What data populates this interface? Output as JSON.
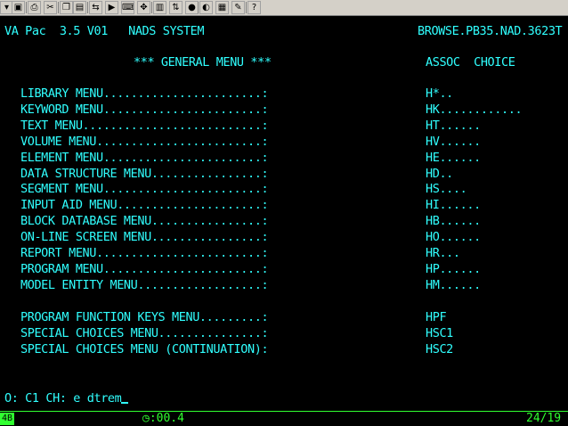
{
  "toolbar": {
    "buttons": [
      {
        "name": "dropdown-button",
        "glyph": "▾"
      },
      {
        "name": "save-icon",
        "glyph": "▣"
      },
      {
        "name": "print-icon",
        "glyph": "⎙"
      },
      {
        "name": "cut-icon",
        "glyph": "✂"
      },
      {
        "name": "copy-icon",
        "glyph": "❐"
      },
      {
        "name": "paste-icon",
        "glyph": "▤"
      },
      {
        "name": "connect-icon",
        "glyph": "⇆"
      },
      {
        "name": "macro-icon",
        "glyph": "▶"
      },
      {
        "name": "keyboard-icon",
        "glyph": "⌨"
      },
      {
        "name": "tools-icon",
        "glyph": "✥"
      },
      {
        "name": "chart-icon",
        "glyph": "▥"
      },
      {
        "name": "transfer-icon",
        "glyph": "⇅"
      },
      {
        "name": "record-icon",
        "glyph": "●"
      },
      {
        "name": "colors-icon",
        "glyph": "◐"
      },
      {
        "name": "settings-icon",
        "glyph": "▦"
      },
      {
        "name": "edit-icon",
        "glyph": "✎"
      },
      {
        "name": "help-icon",
        "glyph": "?"
      }
    ]
  },
  "screen": {
    "header_left": "VA Pac  3.5 V01   NADS SYSTEM",
    "header_right": "BROWSE.PB35.NAD.3623T",
    "menu_title": "*** GENERAL MENU ***",
    "assoc_header": "ASSOC  CHOICE",
    "menu_items": [
      {
        "label": "LIBRARY MENU.......................:",
        "code": "H*.."
      },
      {
        "label": "KEYWORD MENU.......................:",
        "code": "HK............"
      },
      {
        "label": "TEXT MENU..........................:",
        "code": "HT......"
      },
      {
        "label": "VOLUME MENU........................:",
        "code": "HV......"
      },
      {
        "label": "ELEMENT MENU.......................:",
        "code": "HE......"
      },
      {
        "label": "DATA STRUCTURE MENU................:",
        "code": "HD.."
      },
      {
        "label": "SEGMENT MENU.......................:",
        "code": "HS...."
      },
      {
        "label": "INPUT AID MENU.....................:",
        "code": "HI......"
      },
      {
        "label": "BLOCK DATABASE MENU................:",
        "code": "HB......"
      },
      {
        "label": "ON-LINE SCREEN MENU................:",
        "code": "HO......"
      },
      {
        "label": "REPORT MENU........................:",
        "code": "HR..."
      },
      {
        "label": "PROGRAM MENU.......................:",
        "code": "HP......"
      },
      {
        "label": "MODEL ENTITY MENU..................:",
        "code": "HM......"
      }
    ],
    "special_items": [
      {
        "label": "PROGRAM FUNCTION KEYS MENU.........:",
        "code": "HPF"
      },
      {
        "label": "SPECIAL CHOICES MENU...............:",
        "code": "HSC1"
      },
      {
        "label": "SPECIAL CHOICES MENU (CONTINUATION):",
        "code": "HSC2"
      }
    ],
    "command_prefix": "O: C1 CH: ",
    "command_value": "e dtrem"
  },
  "status": {
    "session": "4B",
    "timer": ":00.4",
    "cursor_position": "24/19"
  },
  "colors": {
    "text": "#30ffff",
    "status": "#30ff30",
    "background": "#000000"
  }
}
